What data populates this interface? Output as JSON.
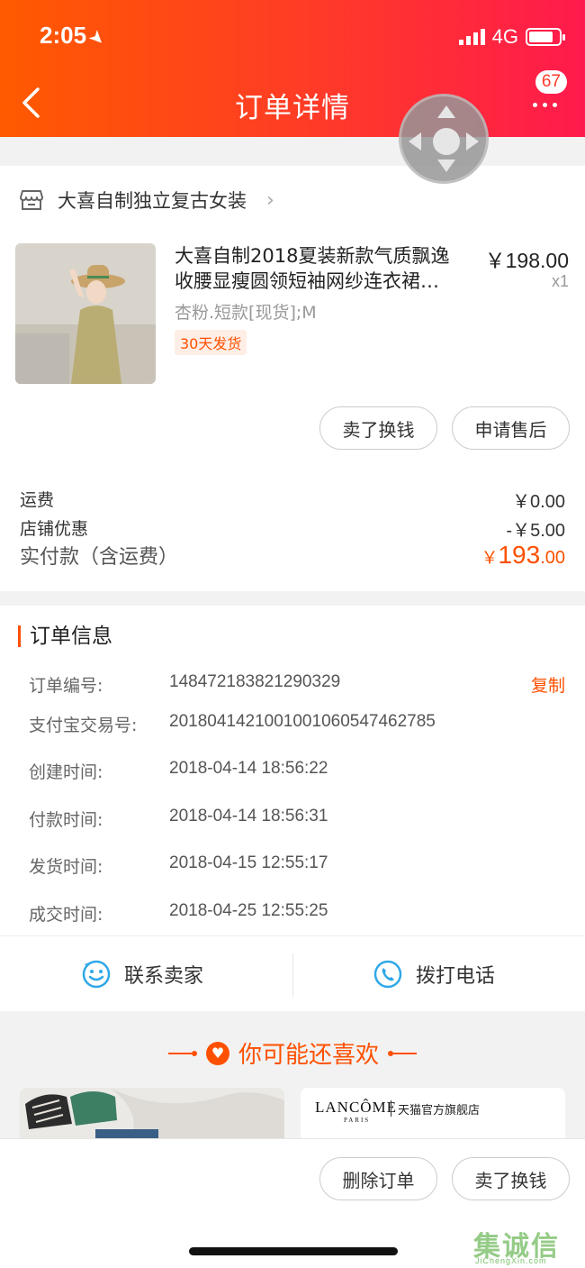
{
  "status_bar": {
    "time": "2:05",
    "network": "4G"
  },
  "header": {
    "title": "订单详情",
    "message_count": "67"
  },
  "shop": {
    "name": "大喜自制独立复古女装"
  },
  "product": {
    "title_line1": "大喜自制2018夏装新款气质飘逸",
    "title_line2": "收腰显瘦圆领短袖网纱连衣裙…",
    "price": "￥198.00",
    "quantity": "x1",
    "sku": "杏粉.短款[现货];M",
    "tag": "30天发货",
    "buttons": {
      "sell_for_cash": "卖了换钱",
      "after_sale": "申请售后"
    }
  },
  "fees": {
    "shipping_label": "运费",
    "shipping_value": "￥0.00",
    "discount_label": "店铺优惠",
    "discount_value": "-￥5.00",
    "total_label": "实付款（含运费）",
    "total_currency": "￥",
    "total_integer": "193",
    "total_decimal": ".00"
  },
  "order_info": {
    "title": "订单信息",
    "copy_label": "复制",
    "rows": [
      {
        "label": "订单编号:",
        "value": "148472183821290329"
      },
      {
        "label": "支付宝交易号:",
        "value": "2018041421001001060547462785"
      },
      {
        "label": "创建时间:",
        "value": "2018-04-14 18:56:22"
      },
      {
        "label": "付款时间:",
        "value": "2018-04-14 18:56:31"
      },
      {
        "label": "发货时间:",
        "value": "2018-04-15 12:55:17"
      },
      {
        "label": "成交时间:",
        "value": "2018-04-25 12:55:25"
      }
    ],
    "contact_seller": "联系卖家",
    "call_phone": "拨打电话"
  },
  "recommend": {
    "title": "你可能还喜欢",
    "brand_logo": "LANCÔME",
    "brand_sub": "PARIS",
    "brand_store": "天猫官方旗舰店"
  },
  "bottom_bar": {
    "delete_order": "删除订单",
    "sell_for_cash": "卖了换钱"
  },
  "watermark": {
    "text": "集诚信",
    "url": "JiChengXin.com"
  },
  "colors": {
    "accent": "#ff5000",
    "header_start": "#ff5a00",
    "header_end": "#ff1a4d"
  }
}
